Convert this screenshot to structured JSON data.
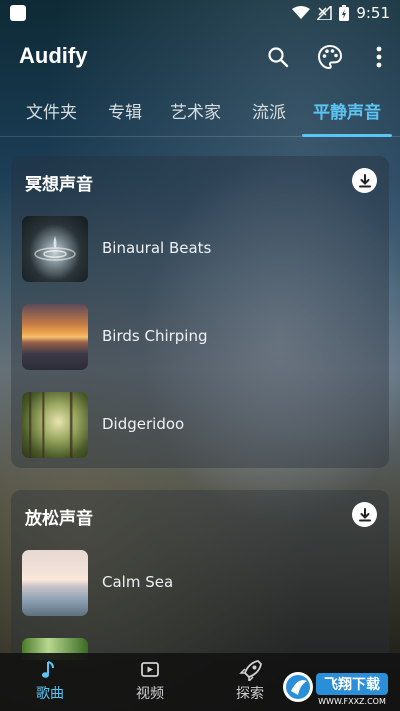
{
  "status": {
    "time": "9:51"
  },
  "app": {
    "title": "Audify"
  },
  "tabs": [
    {
      "label": "文件夹"
    },
    {
      "label": "专辑"
    },
    {
      "label": "艺术家"
    },
    {
      "label": "流派"
    },
    {
      "label": "平静声音"
    }
  ],
  "active_tab": "平静声音",
  "sections": [
    {
      "title": "冥想声音",
      "items": [
        {
          "label": "Binaural Beats"
        },
        {
          "label": "Birds Chirping"
        },
        {
          "label": "Didgeridoo"
        }
      ]
    },
    {
      "title": "放松声音",
      "items": [
        {
          "label": "Calm Sea"
        }
      ]
    }
  ],
  "bottom_nav": [
    {
      "label": "歌曲",
      "icon": "music-note-icon"
    },
    {
      "label": "视频",
      "icon": "video-icon"
    },
    {
      "label": "探索",
      "icon": "rocket-icon"
    }
  ],
  "watermark": {
    "text": "飞翔下载",
    "sub": "WWW.FXXZ.COM"
  },
  "colors": {
    "accent": "#5cc4f2"
  }
}
